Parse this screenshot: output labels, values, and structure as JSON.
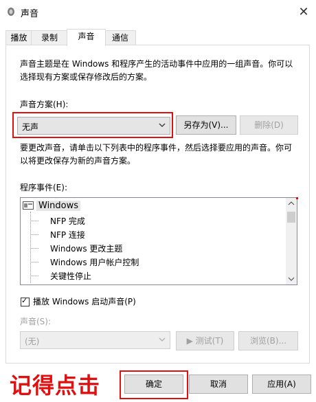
{
  "window": {
    "title": "声音",
    "close_glyph": "✕"
  },
  "tabs": [
    {
      "label": "播放"
    },
    {
      "label": "录制"
    },
    {
      "label": "声音"
    },
    {
      "label": "通信"
    }
  ],
  "intro_text_line1": "声音主题是在 Windows 和程序产生的活动事件中应用的一组声音。你可以",
  "intro_text_line2": "选择现有方案或保存修改后的方案。",
  "scheme": {
    "label": "声音方案(H):",
    "selected": "无声",
    "save_as_label": "另存为(V)...",
    "delete_label": "删除(D)"
  },
  "change_text_line1": "要更改声音，请单击以下列表中的程序事件，然后选择要应用的声音。你可",
  "change_text_line2": "以将更改保存为新的声音方案。",
  "events": {
    "label": "程序事件(E):",
    "root": "Windows",
    "items": [
      "NFP 完成",
      "NFP 连接",
      "Windows 更改主题",
      "Windows 用户帐户控制",
      "关键性停止"
    ]
  },
  "startup_sound": {
    "label": "播放 Windows 启动声音(P)",
    "checked": true,
    "check_glyph": "✓"
  },
  "sound": {
    "label": "声音(S):",
    "selected": "(无)",
    "test_label": "▶ 测试(T)",
    "browse_label": "浏览(B)..."
  },
  "footer": {
    "annotation": "记得点击",
    "ok_label": "确定",
    "cancel_label": "取消",
    "apply_label": "应用(A)"
  },
  "colors": {
    "annotation_red": "#e01010",
    "disabled_text": "#a0a0a0"
  }
}
